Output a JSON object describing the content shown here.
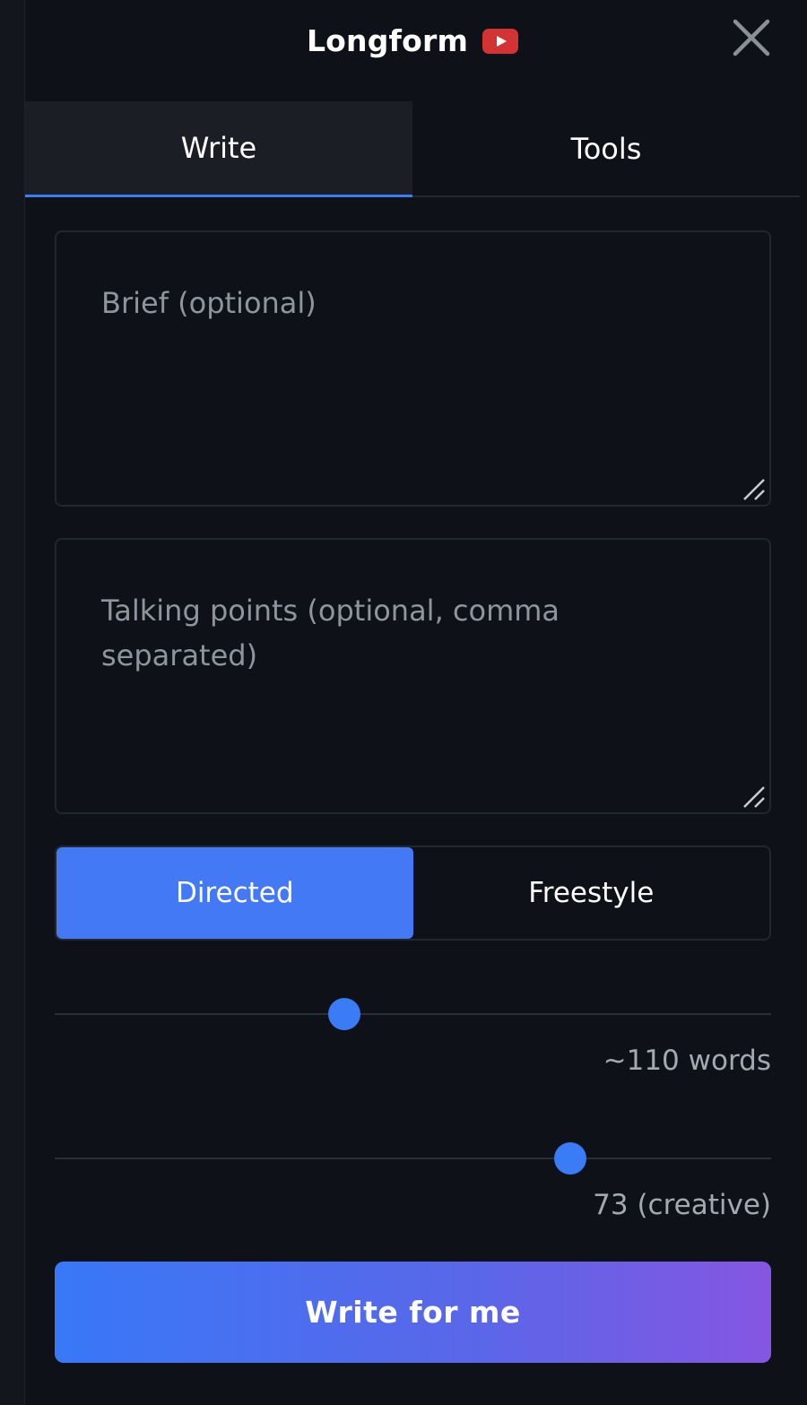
{
  "header": {
    "title": "Longform",
    "brand_icon": "youtube-play-icon",
    "close_icon": "close-icon"
  },
  "tabs": [
    {
      "label": "Write",
      "active": true
    },
    {
      "label": "Tools",
      "active": false
    }
  ],
  "brief": {
    "value": "",
    "placeholder": "Brief (optional)"
  },
  "talking_points": {
    "value": "",
    "placeholder": "Talking points (optional, comma separated)"
  },
  "mode": {
    "options": [
      {
        "label": "Directed",
        "active": true
      },
      {
        "label": "Freestyle",
        "active": false
      }
    ]
  },
  "length_slider": {
    "value_fraction": 0.404,
    "label": "~110 words"
  },
  "creativity_slider": {
    "value_fraction": 0.72,
    "label": "73 (creative)"
  },
  "cta": {
    "label": "Write for me"
  },
  "colors": {
    "background": "#0e1117",
    "accent": "#3d7cf4",
    "active_toggle": "#4479f5",
    "gradient_start": "#3878f7",
    "gradient_end": "#8556e2",
    "youtube_red": "#d33333"
  }
}
